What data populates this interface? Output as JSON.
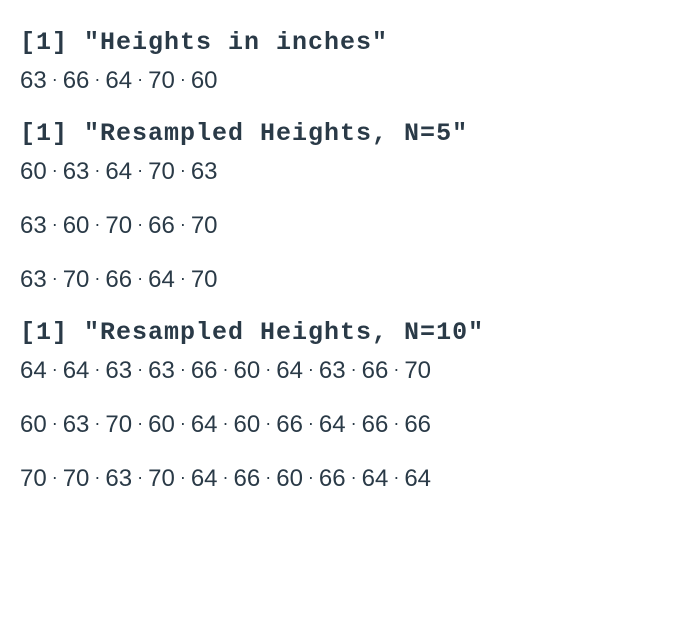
{
  "sections": [
    {
      "header": "[1] \"Heights in inches\"",
      "rows": [
        [
          63,
          66,
          64,
          70,
          60
        ]
      ]
    },
    {
      "header": "[1] \"Resampled Heights, N=5\"",
      "rows": [
        [
          60,
          63,
          64,
          70,
          63
        ],
        [
          63,
          60,
          70,
          66,
          70
        ],
        [
          63,
          70,
          66,
          64,
          70
        ]
      ]
    },
    {
      "header": "[1] \"Resampled Heights, N=10\"",
      "rows": [
        [
          64,
          64,
          63,
          63,
          66,
          60,
          64,
          63,
          66,
          70
        ],
        [
          60,
          63,
          70,
          60,
          64,
          60,
          66,
          64,
          66,
          66
        ],
        [
          70,
          70,
          63,
          70,
          64,
          66,
          60,
          66,
          64,
          64
        ]
      ]
    }
  ]
}
